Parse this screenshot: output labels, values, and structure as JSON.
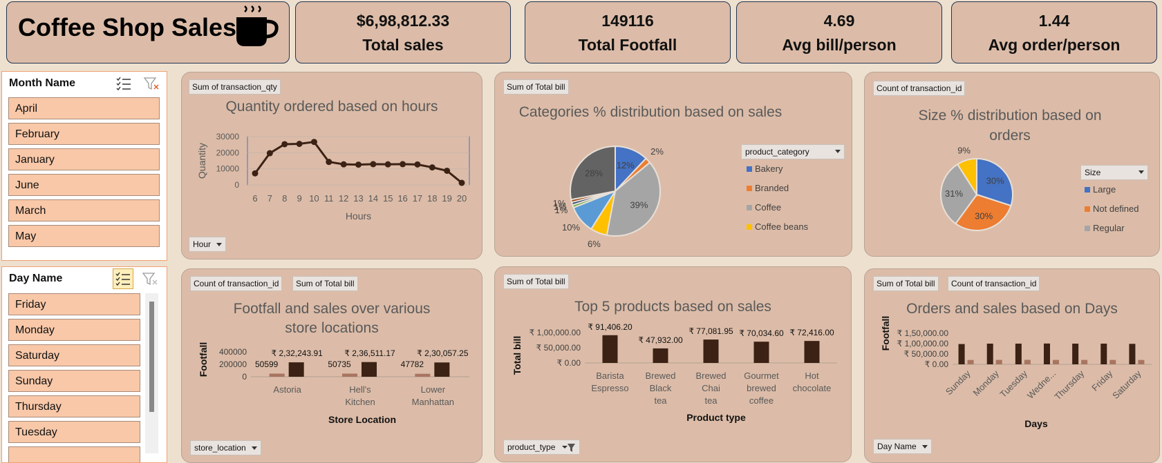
{
  "header": {
    "title": "Coffee Shop Sales"
  },
  "kpis": [
    {
      "value": "$6,98,812.33",
      "label": "Total sales"
    },
    {
      "value": "149116",
      "label": "Total Footfall"
    },
    {
      "value": "4.69",
      "label": "Avg bill/person"
    },
    {
      "value": "1.44",
      "label": "Avg order/person"
    }
  ],
  "month_slicer": {
    "title": "Month Name",
    "items": [
      "April",
      "February",
      "January",
      "June",
      "March",
      "May"
    ]
  },
  "day_slicer": {
    "title": "Day Name",
    "items": [
      "Friday",
      "Monday",
      "Saturday",
      "Sunday",
      "Thursday",
      "Tuesday"
    ]
  },
  "hours_card": {
    "field_button": "Sum of transaction_qty",
    "axis_button": "Hour"
  },
  "category_card": {
    "field_button": "Sum of Total bill",
    "legend_button": "product_category"
  },
  "size_card": {
    "field_button": "Count of transaction_id",
    "legend_button": "Size"
  },
  "store_card": {
    "field_buttons": [
      "Count of transaction_id",
      "Sum of Total bill"
    ],
    "axis_button": "store_location"
  },
  "products_card": {
    "field_button": "Sum of Total bill",
    "axis_button": "product_type"
  },
  "days_card": {
    "field_buttons": [
      "Sum of Total bill",
      "Count of transaction_id"
    ],
    "axis_button": "Day Name"
  },
  "colors": {
    "card": "#dcbca8",
    "bar_dark": "#3b2214",
    "bar_light": "#a87560",
    "line": "#3b2214",
    "slicer_item": "#f8c8a8",
    "slicer_border": "#f0a070"
  },
  "chart_data": [
    {
      "type": "line",
      "title": "Quantity ordered based on hours",
      "xlabel": "Hours",
      "ylabel": "Quantity",
      "x": [
        "6",
        "7",
        "8",
        "9",
        "10",
        "11",
        "12",
        "13",
        "14",
        "15",
        "16",
        "17",
        "18",
        "19",
        "20"
      ],
      "yticks": [
        "0",
        "10000",
        "20000",
        "30000"
      ],
      "ylim": [
        0,
        30000
      ],
      "series": [
        {
          "values": [
            7200,
            19700,
            25300,
            25500,
            26700,
            14300,
            12800,
            12600,
            12900,
            12800,
            12900,
            12700,
            10900,
            8800,
            1300
          ]
        }
      ]
    },
    {
      "type": "pie",
      "title": "Categories % distribution based on sales",
      "legend": [
        "Bakery",
        "Branded",
        "Coffee",
        "Coffee beans"
      ],
      "slices": [
        {
          "label": "12%",
          "value": 12,
          "color": "#4472c4"
        },
        {
          "label": "2%",
          "value": 2,
          "color": "#ed7d31"
        },
        {
          "label": "39%",
          "value": 39,
          "color": "#a5a5a5"
        },
        {
          "label": "6%",
          "value": 6,
          "color": "#ffc000"
        },
        {
          "label": "10%",
          "value": 10,
          "color": "#5b9bd5"
        },
        {
          "label": "1%",
          "value": 1,
          "color": "#70ad47"
        },
        {
          "label": "1%",
          "value": 1,
          "color": "#264478"
        },
        {
          "label": "1%",
          "value": 1,
          "color": "#9e480e"
        },
        {
          "label": "28%",
          "value": 28,
          "color": "#636363"
        }
      ]
    },
    {
      "type": "pie",
      "title": "Size % distribution based on orders",
      "legend": [
        "Large",
        "Not defined",
        "Regular"
      ],
      "slices": [
        {
          "label": "30%",
          "value": 30,
          "color": "#4472c4"
        },
        {
          "label": "30%",
          "value": 30,
          "color": "#ed7d31"
        },
        {
          "label": "31%",
          "value": 31,
          "color": "#a5a5a5"
        },
        {
          "label": "9%",
          "value": 9,
          "color": "#ffc000"
        }
      ]
    },
    {
      "type": "bar",
      "title": "Footfall and sales over various store locations",
      "xlabel": "Store Location",
      "ylabel": "Footfall",
      "categories": [
        "Astoria",
        "Hell's Kitchen",
        "Lower Manhattan"
      ],
      "yticks": [
        "0",
        "200000",
        "400000"
      ],
      "ylim": [
        0,
        400000
      ],
      "series": [
        {
          "values": [
            50599,
            50735,
            47782
          ],
          "labels": [
            "50599",
            "50735",
            "47782"
          ]
        },
        {
          "values": [
            232243.91,
            236511.17,
            230057.25
          ],
          "labels": [
            "₹ 2,32,243.91",
            "₹ 2,36,511.17",
            "₹ 2,30,057.25"
          ]
        }
      ]
    },
    {
      "type": "bar",
      "title": "Top 5 products based on sales",
      "xlabel": "Product type",
      "ylabel": "Total bill",
      "categories": [
        "Barista Espresso",
        "Brewed Black tea",
        "Brewed Chai tea",
        "Gourmet brewed coffee",
        "Hot chocolate"
      ],
      "yticks": [
        "₹ 0.00",
        "₹ 50,000.00",
        "₹ 1,00,000.00"
      ],
      "ylim": [
        0,
        100000
      ],
      "series": [
        {
          "values": [
            91406.2,
            47932.0,
            77081.95,
            70034.6,
            72416.0
          ],
          "labels": [
            "₹ 91,406.20",
            "₹ 47,932.00",
            "₹ 77,081.95",
            "₹ 70,034.60",
            "₹ 72,416.00"
          ]
        }
      ]
    },
    {
      "type": "bar",
      "title": "Orders and sales based on Days",
      "xlabel": "Days",
      "ylabel": "Footfall",
      "categories": [
        "Sunday",
        "Monday",
        "Tuesday",
        "Wedne...",
        "Thursday",
        "Friday",
        "Saturday"
      ],
      "yticks": [
        "₹ 0.00",
        "₹ 50,000.00",
        "₹ 1,00,000.00",
        "₹ 1,50,000.00"
      ],
      "ylim": [
        0,
        150000
      ],
      "series": [
        {
          "values": [
            98000,
            100000,
            100000,
            100500,
            100000,
            100000,
            99000
          ]
        },
        {
          "values": [
            21000,
            21400,
            21600,
            21300,
            21300,
            21300,
            21100
          ]
        }
      ]
    }
  ]
}
